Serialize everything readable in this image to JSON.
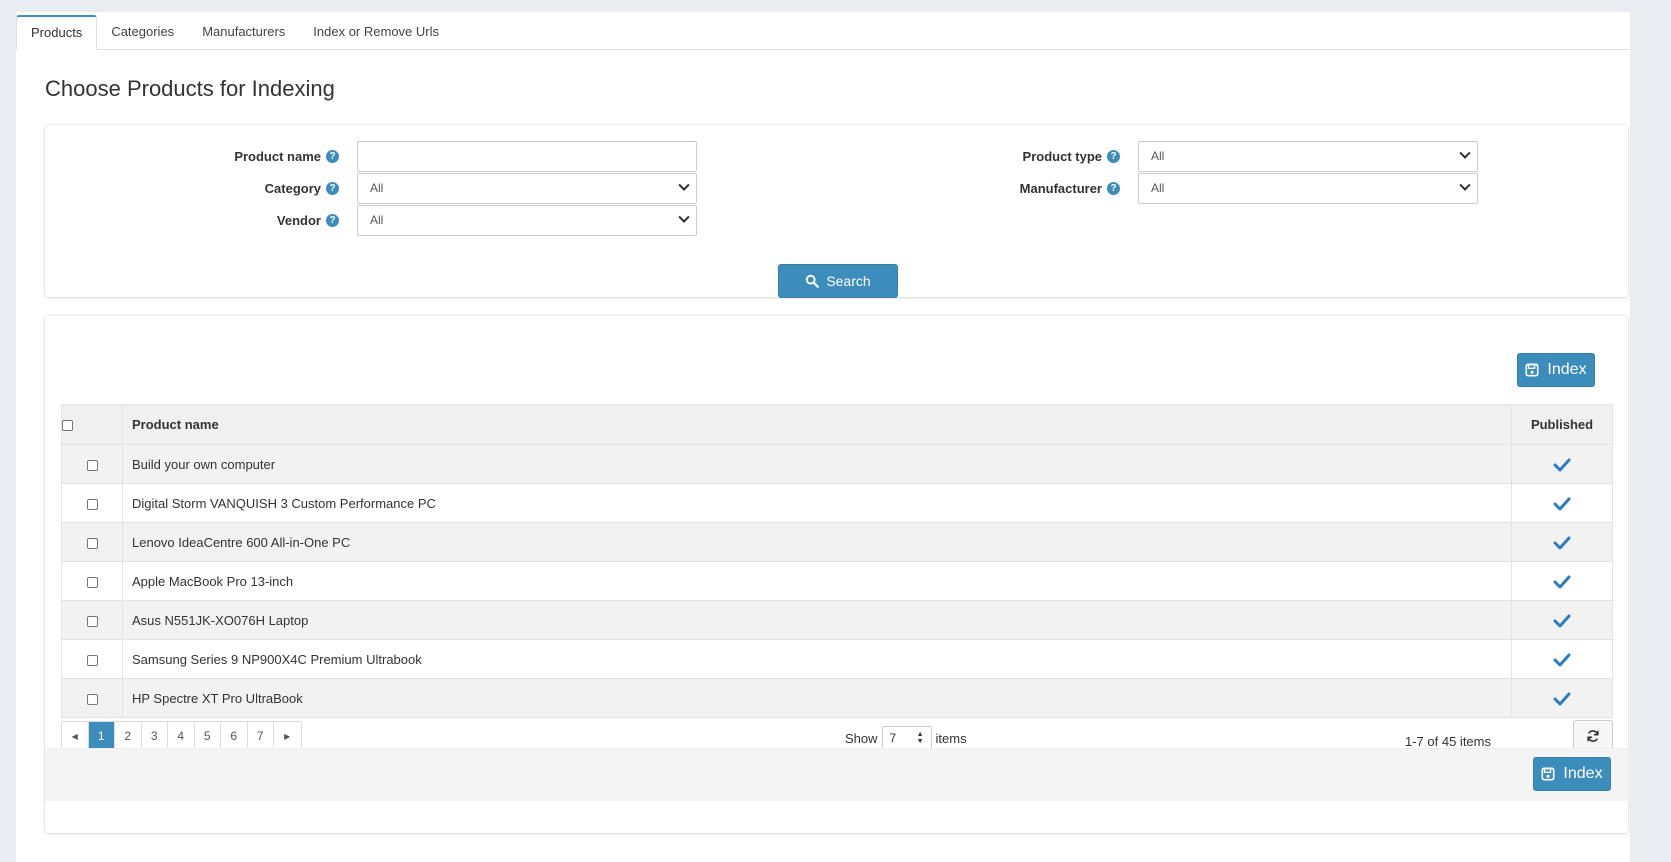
{
  "tabs": [
    "Products",
    "Categories",
    "Manufacturers",
    "Index or Remove Urls"
  ],
  "page_title": "Choose Products for Indexing",
  "search": {
    "product_name_label": "Product name",
    "product_name_value": "",
    "category_label": "Category",
    "category_value": "All",
    "vendor_label": "Vendor",
    "vendor_value": "All",
    "product_type_label": "Product type",
    "product_type_value": "All",
    "manufacturer_label": "Manufacturer",
    "manufacturer_value": "All",
    "search_button": "Search"
  },
  "index_button": "Index",
  "grid": {
    "columns": [
      "Product name",
      "Published"
    ],
    "rows": [
      {
        "name": "Build your own computer",
        "published": true
      },
      {
        "name": "Digital Storm VANQUISH 3 Custom Performance PC",
        "published": true
      },
      {
        "name": "Lenovo IdeaCentre 600 All-in-One PC",
        "published": true
      },
      {
        "name": "Apple MacBook Pro 13-inch",
        "published": true
      },
      {
        "name": "Asus N551JK-XO076H Laptop",
        "published": true
      },
      {
        "name": "Samsung Series 9 NP900X4C Premium Ultrabook",
        "published": true
      },
      {
        "name": "HP Spectre XT Pro UltraBook",
        "published": true
      }
    ]
  },
  "pager": {
    "pages": [
      "1",
      "2",
      "3",
      "4",
      "5",
      "6",
      "7"
    ],
    "current": "1",
    "show_label": "Show",
    "page_size": "7",
    "items_label": "items",
    "range_text": "1-7 of 45 items"
  },
  "colors": {
    "accent": "#3c8dbc",
    "check": "#2b7cc1"
  },
  "icons": [
    "help-icon",
    "search-icon",
    "save-icon",
    "check-icon",
    "refresh-icon",
    "chevron-down-icon",
    "arrow-left-icon",
    "arrow-right-icon"
  ]
}
